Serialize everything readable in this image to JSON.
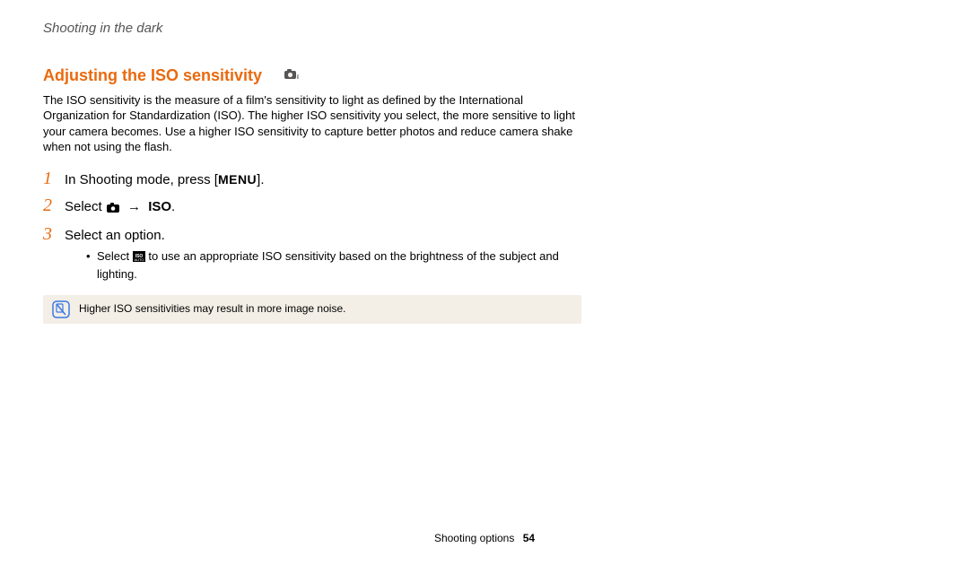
{
  "breadcrumb": "Shooting in the dark",
  "heading": "Adjusting the ISO sensitivity",
  "intro": "The ISO sensitivity is the measure of a film's sensitivity to light as defined by the International Organization for Standardization (ISO). The higher ISO sensitivity you select, the more sensitive to light your camera becomes. Use a higher ISO sensitivity to capture better photos and reduce camera shake when not using the flash.",
  "steps": {
    "s1_a": "In Shooting mode, press [",
    "s1_menu": "MENU",
    "s1_b": "].",
    "s2_a": "Select ",
    "s2_iso": "ISO",
    "s2_b": ".",
    "s3": "Select an option.",
    "s3_sub_a": "Select ",
    "s3_sub_b": " to use an appropriate ISO sensitivity based on the brightness of the subject and lighting."
  },
  "note": "Higher ISO sensitivities may result in more image noise.",
  "footer_label": "Shooting options",
  "footer_page": "54"
}
